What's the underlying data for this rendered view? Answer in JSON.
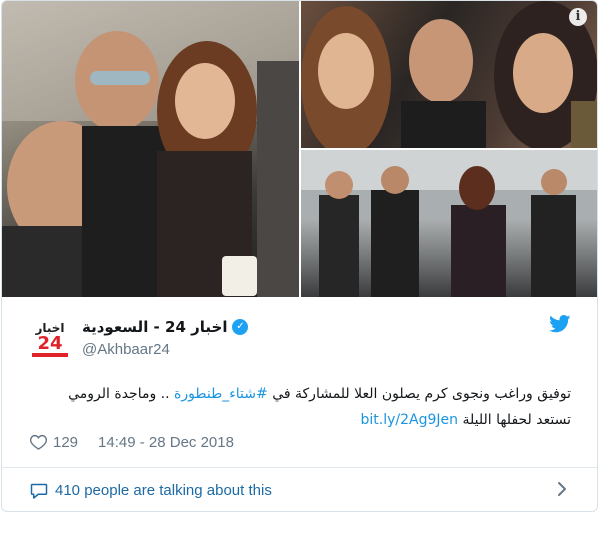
{
  "tweet": {
    "display_name": "اخبار 24 - السعودية",
    "handle": "@Akhbaar24",
    "avatar": {
      "logo_top": "اخبار",
      "logo_number": "24"
    },
    "text_line1_part1": "توفيق وراغب ونجوى كرم يصلون العلا للمشاركة في ",
    "hashtag": "#شتاء_طنطورة",
    "text_line1_part2": " .. وماجدة الرومي",
    "text_line2": "تستعد لحفلها الليلة ",
    "link": "bit.ly/2Ag9Jen",
    "like_count": "129",
    "timestamp": "14:49 - 28 Dec 2018",
    "conversation": "410 people are talking about this"
  },
  "icons": {
    "verified": "verified-badge-icon",
    "bird": "twitter-bird-icon",
    "heart": "heart-icon",
    "bubble": "speech-bubble-icon",
    "chevron": "chevron-right-icon",
    "info": "info-icon"
  },
  "colors": {
    "twitter_blue": "#1da1f2",
    "link_blue": "#1b95e0",
    "muted_gray": "#657786",
    "conversation_blue": "#1c6aa5",
    "brand_red": "#e0232a"
  },
  "media": {
    "info_glyph": "i"
  }
}
